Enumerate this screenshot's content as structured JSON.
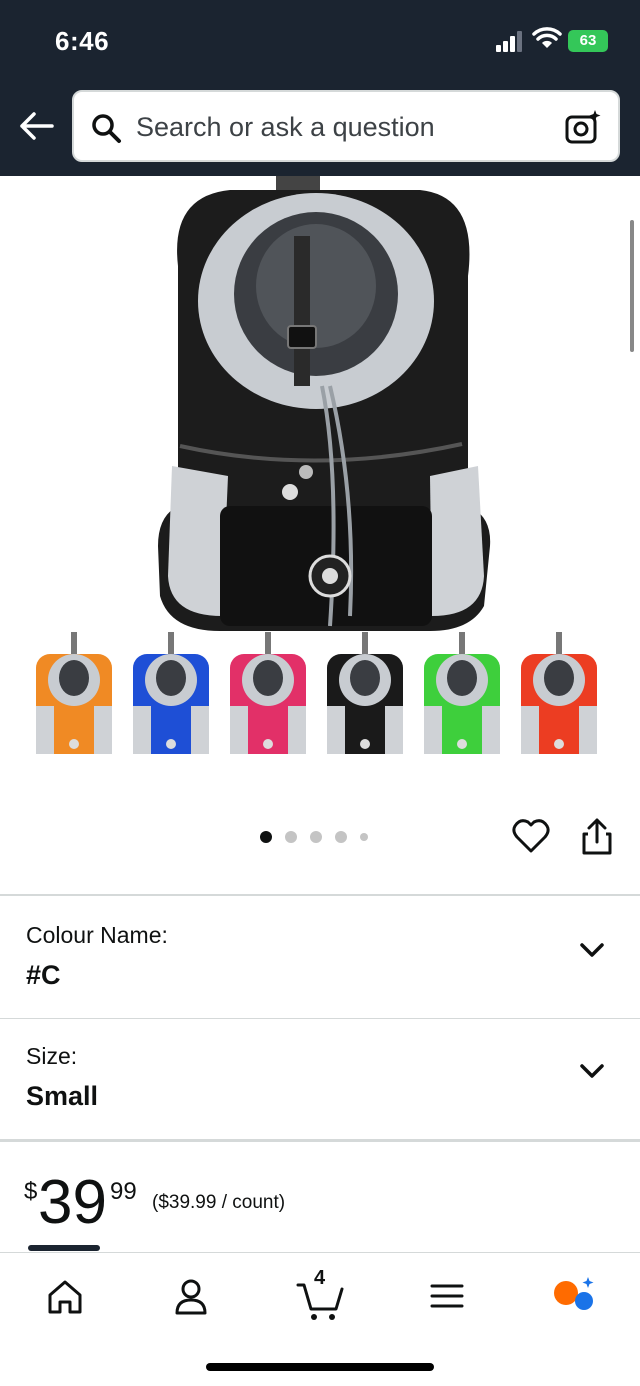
{
  "status_bar": {
    "time": "6:46",
    "battery": "63"
  },
  "header": {
    "search_placeholder": "Search or ask a question"
  },
  "gallery": {
    "dot_count": 5,
    "active_index": 0,
    "swatches": [
      {
        "name": "orange",
        "color": "#f08a24"
      },
      {
        "name": "blue",
        "color": "#1e4fd6"
      },
      {
        "name": "pink",
        "color": "#e23068"
      },
      {
        "name": "black",
        "color": "#1a1a1a"
      },
      {
        "name": "green",
        "color": "#3ecf3c"
      },
      {
        "name": "red",
        "color": "#ec3d22"
      }
    ]
  },
  "variants": {
    "colour": {
      "label": "Colour Name:",
      "value": "#C"
    },
    "size": {
      "label": "Size:",
      "value": "Small"
    }
  },
  "price": {
    "currency": "$",
    "whole": "39",
    "fraction": "99",
    "unit_price": "($39.99 / count)"
  },
  "bottom_nav": {
    "cart_count": "4",
    "active_tab": "home"
  },
  "colors": {
    "header_bg": "#1b2430",
    "accent_orange": "#ff6b00",
    "accent_blue": "#1a73e8"
  }
}
